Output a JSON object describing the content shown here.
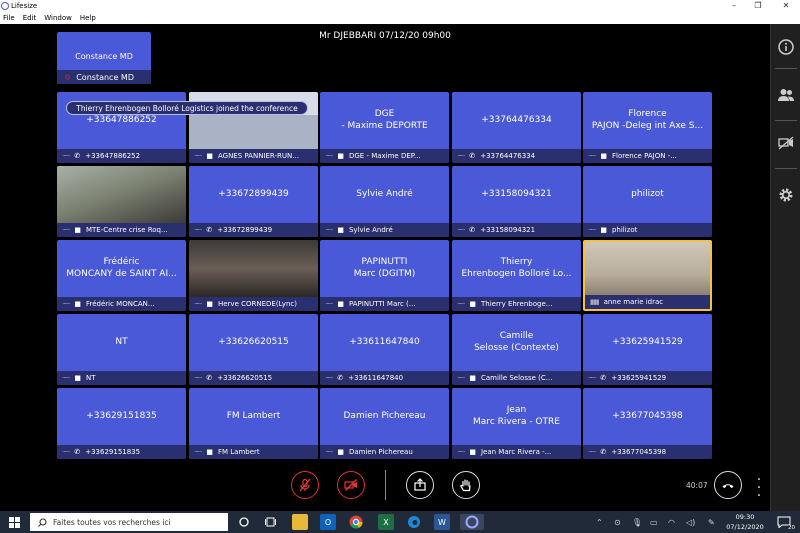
{
  "window": {
    "title": "Lifesize"
  },
  "menu": [
    "File",
    "Edit",
    "Window",
    "Help"
  ],
  "meeting": {
    "title": "Mr DJEBBARI 07/12/20 09h00",
    "elapsed": "40:07"
  },
  "self": {
    "name": "Constance MD",
    "bar_name": "Constance MD"
  },
  "toast": "Thierry Ehrenbogen Bolloré Logistics joined the conference",
  "tiles": [
    {
      "name": "+33647886252",
      "label": "+33647886252",
      "icon": "phone"
    },
    {
      "name": "",
      "label": "AGNES PANNIER-RUN...",
      "icon": "video",
      "video": "v1"
    },
    {
      "name": "DGE\n- Maxime DEPORTE",
      "label": "DGE - Maxime DEP...",
      "icon": "video"
    },
    {
      "name": "+33764476334",
      "label": "+33764476334",
      "icon": "phone"
    },
    {
      "name": "Florence\nPAJON -Deleg int Axe S...",
      "label": "Florence PAJON -...",
      "icon": "video"
    },
    {
      "name": "",
      "label": "MTE-Centre crise Roq...",
      "icon": "video",
      "video": "v2"
    },
    {
      "name": "+33672899439",
      "label": "+33672899439",
      "icon": "phone"
    },
    {
      "name": "Sylvie André",
      "label": "Sylvie André",
      "icon": "video"
    },
    {
      "name": "+33158094321",
      "label": "+33158094321",
      "icon": "phone"
    },
    {
      "name": "philizot",
      "label": "philizot",
      "icon": "video"
    },
    {
      "name": "Frédéric\nMONCANY de SAINT AI...",
      "label": "Frédéric MONCAN...",
      "icon": "video"
    },
    {
      "name": "",
      "label": "Herve CORNEDE(Lync)",
      "icon": "video",
      "video": "v3"
    },
    {
      "name": "PAPINUTTI\nMarc (DGITM)",
      "label": "PAPINUTTI Marc (...",
      "icon": "video"
    },
    {
      "name": "Thierry\nEhrenbogen Bolloré Lo...",
      "label": "Thierry Ehrenboge...",
      "icon": "video"
    },
    {
      "name": "",
      "label": "anne marie idrac",
      "icon": "audio",
      "video": "v4",
      "selected": true
    },
    {
      "name": "NT",
      "label": "NT",
      "icon": "video"
    },
    {
      "name": "+33626620515",
      "label": "+33626620515",
      "icon": "phone"
    },
    {
      "name": "+33611647840",
      "label": "+33611647840",
      "icon": "phone"
    },
    {
      "name": "Camille\nSelosse (Contexte)",
      "label": "Camille Selosse (C...",
      "icon": "video"
    },
    {
      "name": "+33625941529",
      "label": "+33625941529",
      "icon": "phone"
    },
    {
      "name": "+33629151835",
      "label": "+33629151835",
      "icon": "phone"
    },
    {
      "name": "FM Lambert",
      "label": "FM Lambert",
      "icon": "video"
    },
    {
      "name": "Damien Pichereau",
      "label": "Damien Pichereau",
      "icon": "video"
    },
    {
      "name": "Jean\nMarc Rivera - OTRE",
      "label": "Jean Marc Rivera -...",
      "icon": "video"
    },
    {
      "name": "+33677045398",
      "label": "+33677045398",
      "icon": "phone"
    }
  ],
  "taskbar": {
    "search_placeholder": "Faites toutes vos recherches ici",
    "time": "09:30",
    "date": "07/12/2020",
    "notifications": "20"
  },
  "colors": {
    "tile": "#4a59d8",
    "tile_bar": "#2a2f70",
    "active_speaker": "#f2c14a",
    "end_call": "#d33333"
  }
}
